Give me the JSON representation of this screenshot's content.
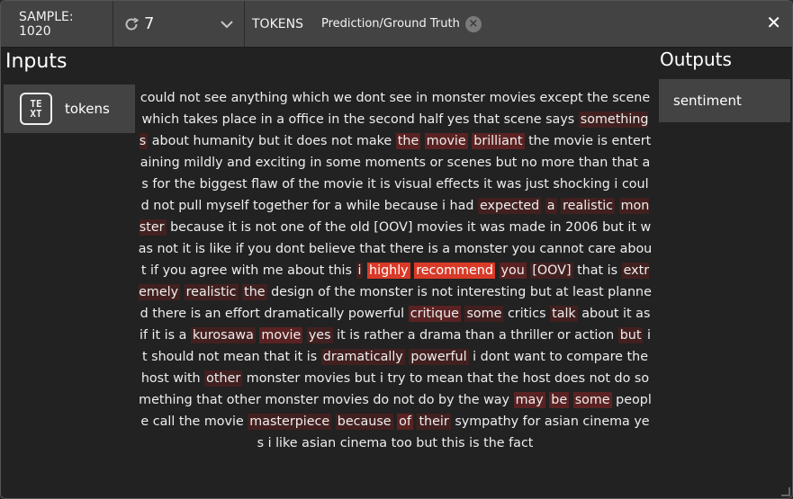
{
  "header": {
    "sample_label": "SAMPLE: 1020",
    "mode_value": "7",
    "tokens_label": "TOKENS",
    "chip_label": "Prediction/Ground Truth",
    "close_glyph": "✕"
  },
  "inputs": {
    "title": "Inputs",
    "items": [
      {
        "label": "tokens",
        "icon": "text-icon"
      }
    ]
  },
  "outputs": {
    "title": "Outputs",
    "items": [
      {
        "label": "sentiment"
      }
    ]
  },
  "colors": {
    "highlight_strong": "#d93a28",
    "highlight_faint": "#5a2424",
    "panel": "#434343"
  },
  "tokens": [
    {
      "t": "could not see anything which we dont see in monster movies except the scene which takes place in a office in the second half yes that scene says "
    },
    {
      "t": "somethings",
      "h": 1
    },
    {
      "t": " about humanity but it does not make "
    },
    {
      "t": "the",
      "h": 2
    },
    {
      "t": " "
    },
    {
      "t": "movie",
      "h": 2
    },
    {
      "t": " "
    },
    {
      "t": "brilliant",
      "h": 2
    },
    {
      "t": " the movie is entertaining mildly and exciting in some moments or scenes but no more than that as for the biggest flaw of the movie it is visual effects it was just shocking i could not pull myself together for a while because i had "
    },
    {
      "t": "expected",
      "h": 1
    },
    {
      "t": " "
    },
    {
      "t": "a",
      "h": 1
    },
    {
      "t": " "
    },
    {
      "t": "realistic",
      "h": 1
    },
    {
      "t": " "
    },
    {
      "t": "monster",
      "h": 1
    },
    {
      "t": " because it is not one of the old [OOV] movies it was made in 2006 but it was not it is like if you dont believe that there is a monster you cannot care about if you agree with me about this "
    },
    {
      "t": "i",
      "h": 1
    },
    {
      "t": " "
    },
    {
      "t": "highly",
      "h": 4
    },
    {
      "t": " "
    },
    {
      "t": "recommend",
      "h": 4
    },
    {
      "t": " "
    },
    {
      "t": "you",
      "h": 2
    },
    {
      "t": " "
    },
    {
      "t": "[OOV]",
      "h": 1
    },
    {
      "t": " that is "
    },
    {
      "t": "extremely",
      "h": 1
    },
    {
      "t": " "
    },
    {
      "t": "realistic",
      "h": 1
    },
    {
      "t": " "
    },
    {
      "t": "the",
      "h": 1
    },
    {
      "t": " design of the monster is not interesting but at least planned there is an effort dramatically powerful "
    },
    {
      "t": "critique",
      "h": 2
    },
    {
      "t": " "
    },
    {
      "t": "some",
      "h": 1
    },
    {
      "t": " critics "
    },
    {
      "t": "talk",
      "h": 1
    },
    {
      "t": " about it as if it is a "
    },
    {
      "t": "kurosawa",
      "h": 1
    },
    {
      "t": " "
    },
    {
      "t": "movie",
      "h": 2
    },
    {
      "t": " "
    },
    {
      "t": "yes",
      "h": 1
    },
    {
      "t": " it is rather a drama than a thriller or action "
    },
    {
      "t": "but",
      "h": 1
    },
    {
      "t": " it should not mean that it is "
    },
    {
      "t": "dramatically",
      "h": 1
    },
    {
      "t": " "
    },
    {
      "t": "powerful",
      "h": 1
    },
    {
      "t": " i dont want to compare the host with "
    },
    {
      "t": "other",
      "h": 1
    },
    {
      "t": " monster movies but i try to mean that the host does not do something that other monster movies do not do by the way "
    },
    {
      "t": "may",
      "h": 2
    },
    {
      "t": " "
    },
    {
      "t": "be",
      "h": 2
    },
    {
      "t": " "
    },
    {
      "t": "some",
      "h": 2
    },
    {
      "t": " people call the movie "
    },
    {
      "t": "masterpiece",
      "h": 1
    },
    {
      "t": " "
    },
    {
      "t": "because",
      "h": 1
    },
    {
      "t": " "
    },
    {
      "t": "of",
      "h": 2
    },
    {
      "t": " "
    },
    {
      "t": "their",
      "h": 1
    },
    {
      "t": " sympathy for asian cinema yes i like asian cinema too but this is the fact"
    }
  ]
}
